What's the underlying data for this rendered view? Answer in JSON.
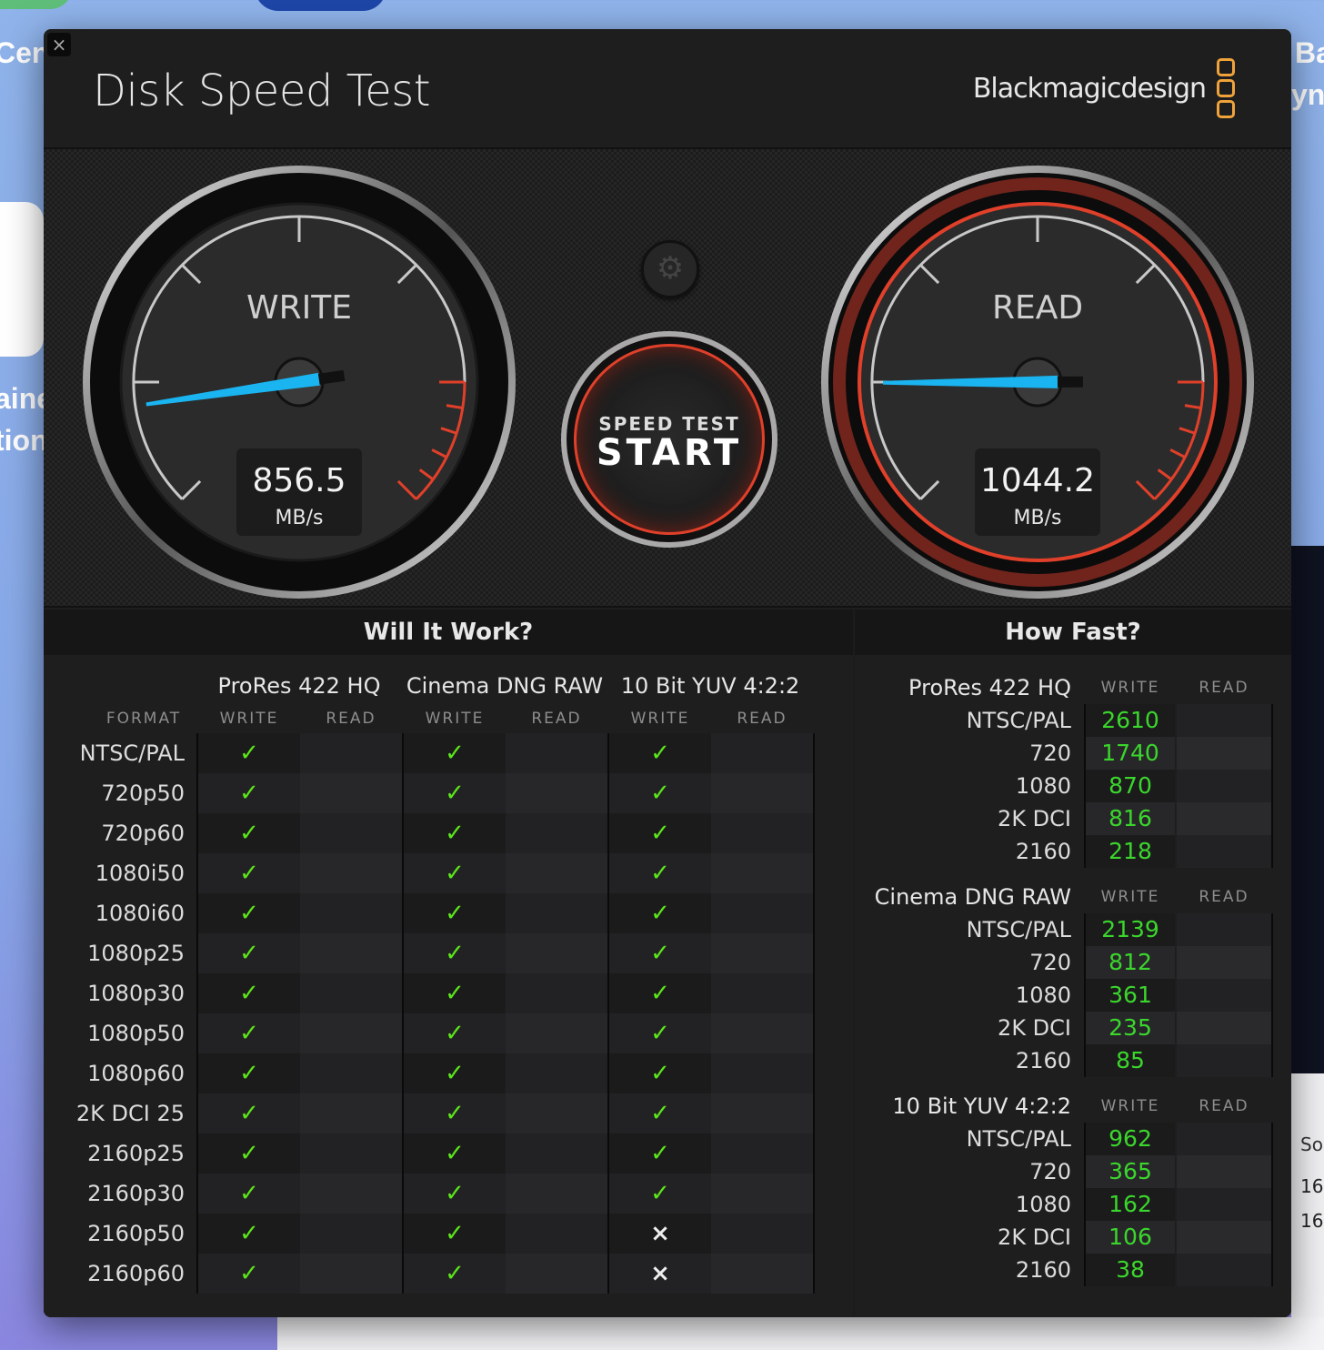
{
  "desktop": {
    "fragments": [
      "Cent",
      "aine",
      "tion",
      "Ba",
      "ync",
      "So",
      "16",
      "16"
    ]
  },
  "window": {
    "close_label": "×",
    "title": "Disk Speed Test",
    "brand": "Blackmagicdesign"
  },
  "gauges": {
    "write": {
      "label": "WRITE",
      "value": 856.5,
      "value_text": "856.5",
      "unit": "MB/s"
    },
    "read": {
      "label": "READ",
      "value": 1044.2,
      "value_text": "1044.2",
      "unit": "MB/s"
    }
  },
  "settings": {
    "icon": "gear-icon"
  },
  "start_button": {
    "line1": "SPEED TEST",
    "line2": "START"
  },
  "colors": {
    "needle": "#1ab4f0",
    "redzone": "#e0402a",
    "pass": "#5ce61a",
    "fast": "#3bd62c",
    "brand_orange": "#f0a33a"
  },
  "will_it_work": {
    "title": "Will It Work?",
    "format_header": "FORMAT",
    "codecs": [
      "ProRes 422 HQ",
      "Cinema DNG RAW",
      "10 Bit YUV 4:2:2"
    ],
    "write_label": "WRITE",
    "read_label": "READ",
    "pass_glyph": "✓",
    "fail_glyph": "×",
    "rows": [
      {
        "format": "NTSC/PAL",
        "results": [
          "pass",
          "",
          "pass",
          "",
          "pass",
          ""
        ]
      },
      {
        "format": "720p50",
        "results": [
          "pass",
          "",
          "pass",
          "",
          "pass",
          ""
        ]
      },
      {
        "format": "720p60",
        "results": [
          "pass",
          "",
          "pass",
          "",
          "pass",
          ""
        ]
      },
      {
        "format": "1080i50",
        "results": [
          "pass",
          "",
          "pass",
          "",
          "pass",
          ""
        ]
      },
      {
        "format": "1080i60",
        "results": [
          "pass",
          "",
          "pass",
          "",
          "pass",
          ""
        ]
      },
      {
        "format": "1080p25",
        "results": [
          "pass",
          "",
          "pass",
          "",
          "pass",
          ""
        ]
      },
      {
        "format": "1080p30",
        "results": [
          "pass",
          "",
          "pass",
          "",
          "pass",
          ""
        ]
      },
      {
        "format": "1080p50",
        "results": [
          "pass",
          "",
          "pass",
          "",
          "pass",
          ""
        ]
      },
      {
        "format": "1080p60",
        "results": [
          "pass",
          "",
          "pass",
          "",
          "pass",
          ""
        ]
      },
      {
        "format": "2K DCI 25",
        "results": [
          "pass",
          "",
          "pass",
          "",
          "pass",
          ""
        ]
      },
      {
        "format": "2160p25",
        "results": [
          "pass",
          "",
          "pass",
          "",
          "pass",
          ""
        ]
      },
      {
        "format": "2160p30",
        "results": [
          "pass",
          "",
          "pass",
          "",
          "pass",
          ""
        ]
      },
      {
        "format": "2160p50",
        "results": [
          "pass",
          "",
          "pass",
          "",
          "fail",
          ""
        ]
      },
      {
        "format": "2160p60",
        "results": [
          "pass",
          "",
          "pass",
          "",
          "fail",
          ""
        ]
      }
    ]
  },
  "how_fast": {
    "title": "How Fast?",
    "write_label": "WRITE",
    "read_label": "READ",
    "groups": [
      {
        "codec": "ProRes 422 HQ",
        "rows": [
          {
            "res": "NTSC/PAL",
            "write": "2610",
            "read": ""
          },
          {
            "res": "720",
            "write": "1740",
            "read": ""
          },
          {
            "res": "1080",
            "write": "870",
            "read": ""
          },
          {
            "res": "2K DCI",
            "write": "816",
            "read": ""
          },
          {
            "res": "2160",
            "write": "218",
            "read": ""
          }
        ]
      },
      {
        "codec": "Cinema DNG RAW",
        "rows": [
          {
            "res": "NTSC/PAL",
            "write": "2139",
            "read": ""
          },
          {
            "res": "720",
            "write": "812",
            "read": ""
          },
          {
            "res": "1080",
            "write": "361",
            "read": ""
          },
          {
            "res": "2K DCI",
            "write": "235",
            "read": ""
          },
          {
            "res": "2160",
            "write": "85",
            "read": ""
          }
        ]
      },
      {
        "codec": "10 Bit YUV 4:2:2",
        "rows": [
          {
            "res": "NTSC/PAL",
            "write": "962",
            "read": ""
          },
          {
            "res": "720",
            "write": "365",
            "read": ""
          },
          {
            "res": "1080",
            "write": "162",
            "read": ""
          },
          {
            "res": "2K DCI",
            "write": "106",
            "read": ""
          },
          {
            "res": "2160",
            "write": "38",
            "read": ""
          }
        ]
      }
    ]
  }
}
